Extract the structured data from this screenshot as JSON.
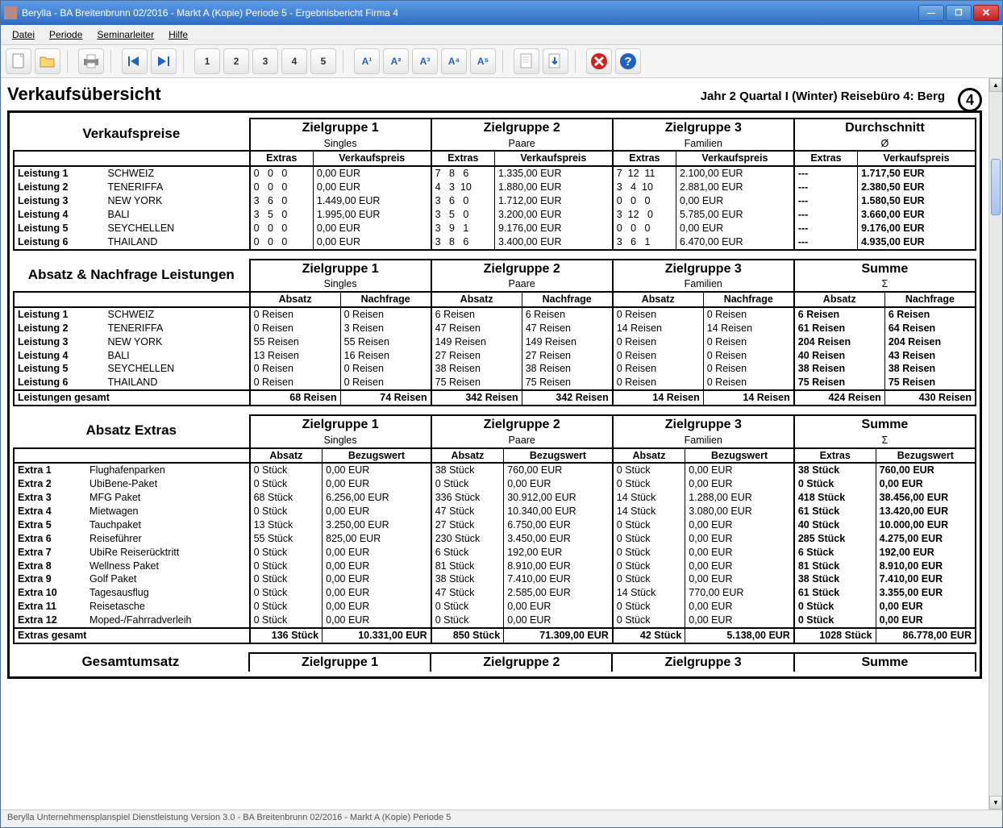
{
  "window_title": "Berylla - BA Breitenbrunn 02/2016 - Markt A (Kopie) Periode 5 - Ergebnisbericht Firma 4",
  "menu": [
    "Datei",
    "Periode",
    "Seminarleiter",
    "Hilfe"
  ],
  "toolbar_numbers": [
    "1",
    "2",
    "3",
    "4",
    "5"
  ],
  "toolbar_a": [
    "A¹",
    "A²",
    "A³",
    "A⁴",
    "A⁵"
  ],
  "page_title": "Verkaufsübersicht",
  "context": "Jahr 2  Quartal I (Winter)  Reisebüro 4: Berg",
  "circle": "4",
  "groups": {
    "g1": {
      "title": "Zielgruppe 1",
      "sub": "Singles"
    },
    "g2": {
      "title": "Zielgruppe 2",
      "sub": "Paare"
    },
    "g3": {
      "title": "Zielgruppe 3",
      "sub": "Familien"
    },
    "avg": {
      "title": "Durchschnitt",
      "sub": "Ø"
    },
    "sum": {
      "title": "Summe",
      "sub": "Σ"
    }
  },
  "block1": {
    "title": "Verkaufspreise",
    "cols": {
      "extras": "Extras",
      "vp": "Verkaufspreis"
    },
    "rows": [
      {
        "l": "Leistung 1",
        "d": "SCHWEIZ",
        "e1": "0   0   0",
        "p1": "0,00 EUR",
        "e2": "7   8   6",
        "p2": "1.335,00 EUR",
        "e3": "7  12  11",
        "p3": "2.100,00 EUR",
        "ea": "---",
        "pa": "1.717,50 EUR"
      },
      {
        "l": "Leistung 2",
        "d": "TENERIFFA",
        "e1": "0   0   0",
        "p1": "0,00 EUR",
        "e2": "4   3  10",
        "p2": "1.880,00 EUR",
        "e3": "3   4  10",
        "p3": "2.881,00 EUR",
        "ea": "---",
        "pa": "2.380,50 EUR"
      },
      {
        "l": "Leistung 3",
        "d": "NEW YORK",
        "e1": "3   6   0",
        "p1": "1.449,00 EUR",
        "e2": "3   6   0",
        "p2": "1.712,00 EUR",
        "e3": "0   0   0",
        "p3": "0,00 EUR",
        "ea": "---",
        "pa": "1.580,50 EUR"
      },
      {
        "l": "Leistung 4",
        "d": "BALI",
        "e1": "3   5   0",
        "p1": "1.995,00 EUR",
        "e2": "3   5   0",
        "p2": "3.200,00 EUR",
        "e3": "3  12   0",
        "p3": "5.785,00 EUR",
        "ea": "---",
        "pa": "3.660,00 EUR"
      },
      {
        "l": "Leistung 5",
        "d": "SEYCHELLEN",
        "e1": "0   0   0",
        "p1": "0,00 EUR",
        "e2": "3   9   1",
        "p2": "9.176,00 EUR",
        "e3": "0   0   0",
        "p3": "0,00 EUR",
        "ea": "---",
        "pa": "9.176,00 EUR"
      },
      {
        "l": "Leistung 6",
        "d": "THAILAND",
        "e1": "0   0   0",
        "p1": "0,00 EUR",
        "e2": "3   8   6",
        "p2": "3.400,00 EUR",
        "e3": "3   6   1",
        "p3": "6.470,00 EUR",
        "ea": "---",
        "pa": "4.935,00 EUR"
      }
    ]
  },
  "block2": {
    "title": "Absatz & Nachfrage Leistungen",
    "cols": {
      "a": "Absatz",
      "n": "Nachfrage"
    },
    "rows": [
      {
        "l": "Leistung 1",
        "d": "SCHWEIZ",
        "a1": "0 Reisen",
        "n1": "0 Reisen",
        "a2": "6 Reisen",
        "n2": "6 Reisen",
        "a3": "0 Reisen",
        "n3": "0 Reisen",
        "as": "6 Reisen",
        "ns": "6 Reisen"
      },
      {
        "l": "Leistung 2",
        "d": "TENERIFFA",
        "a1": "0 Reisen",
        "n1": "3 Reisen",
        "a2": "47 Reisen",
        "n2": "47 Reisen",
        "a3": "14 Reisen",
        "n3": "14 Reisen",
        "as": "61 Reisen",
        "ns": "64 Reisen"
      },
      {
        "l": "Leistung 3",
        "d": "NEW YORK",
        "a1": "55 Reisen",
        "n1": "55 Reisen",
        "a2": "149 Reisen",
        "n2": "149 Reisen",
        "a3": "0 Reisen",
        "n3": "0 Reisen",
        "as": "204 Reisen",
        "ns": "204 Reisen"
      },
      {
        "l": "Leistung 4",
        "d": "BALI",
        "a1": "13 Reisen",
        "n1": "16 Reisen",
        "a2": "27 Reisen",
        "n2": "27 Reisen",
        "a3": "0 Reisen",
        "n3": "0 Reisen",
        "as": "40 Reisen",
        "ns": "43 Reisen"
      },
      {
        "l": "Leistung 5",
        "d": "SEYCHELLEN",
        "a1": "0 Reisen",
        "n1": "0 Reisen",
        "a2": "38 Reisen",
        "n2": "38 Reisen",
        "a3": "0 Reisen",
        "n3": "0 Reisen",
        "as": "38 Reisen",
        "ns": "38 Reisen"
      },
      {
        "l": "Leistung 6",
        "d": "THAILAND",
        "a1": "0 Reisen",
        "n1": "0 Reisen",
        "a2": "75 Reisen",
        "n2": "75 Reisen",
        "a3": "0 Reisen",
        "n3": "0 Reisen",
        "as": "75 Reisen",
        "ns": "75 Reisen"
      }
    ],
    "total": {
      "l": "Leistungen gesamt",
      "a1": "68 Reisen",
      "n1": "74 Reisen",
      "a2": "342 Reisen",
      "n2": "342 Reisen",
      "a3": "14 Reisen",
      "n3": "14 Reisen",
      "as": "424 Reisen",
      "ns": "430 Reisen"
    }
  },
  "block3": {
    "title": "Absatz Extras",
    "cols": {
      "a": "Absatz",
      "b": "Bezugswert",
      "e": "Extras"
    },
    "rows": [
      {
        "l": "Extra 1",
        "d": "Flughafenparken",
        "a1": "0 Stück",
        "b1": "0,00 EUR",
        "a2": "38 Stück",
        "b2": "760,00 EUR",
        "a3": "0 Stück",
        "b3": "0,00 EUR",
        "as": "38 Stück",
        "bs": "760,00 EUR"
      },
      {
        "l": "Extra 2",
        "d": "UbiBene-Paket",
        "a1": "0 Stück",
        "b1": "0,00 EUR",
        "a2": "0 Stück",
        "b2": "0,00 EUR",
        "a3": "0 Stück",
        "b3": "0,00 EUR",
        "as": "0 Stück",
        "bs": "0,00 EUR"
      },
      {
        "l": "Extra 3",
        "d": "MFG Paket",
        "a1": "68 Stück",
        "b1": "6.256,00 EUR",
        "a2": "336 Stück",
        "b2": "30.912,00 EUR",
        "a3": "14 Stück",
        "b3": "1.288,00 EUR",
        "as": "418 Stück",
        "bs": "38.456,00 EUR"
      },
      {
        "l": "Extra 4",
        "d": "Mietwagen",
        "a1": "0 Stück",
        "b1": "0,00 EUR",
        "a2": "47 Stück",
        "b2": "10.340,00 EUR",
        "a3": "14 Stück",
        "b3": "3.080,00 EUR",
        "as": "61 Stück",
        "bs": "13.420,00 EUR"
      },
      {
        "l": "Extra 5",
        "d": "Tauchpaket",
        "a1": "13 Stück",
        "b1": "3.250,00 EUR",
        "a2": "27 Stück",
        "b2": "6.750,00 EUR",
        "a3": "0 Stück",
        "b3": "0,00 EUR",
        "as": "40 Stück",
        "bs": "10.000,00 EUR"
      },
      {
        "l": "Extra 6",
        "d": "Reiseführer",
        "a1": "55 Stück",
        "b1": "825,00 EUR",
        "a2": "230 Stück",
        "b2": "3.450,00 EUR",
        "a3": "0 Stück",
        "b3": "0,00 EUR",
        "as": "285 Stück",
        "bs": "4.275,00 EUR"
      },
      {
        "l": "Extra 7",
        "d": "UbiRe Reiserücktritt",
        "a1": "0 Stück",
        "b1": "0,00 EUR",
        "a2": "6 Stück",
        "b2": "192,00 EUR",
        "a3": "0 Stück",
        "b3": "0,00 EUR",
        "as": "6 Stück",
        "bs": "192,00 EUR"
      },
      {
        "l": "Extra 8",
        "d": "Wellness Paket",
        "a1": "0 Stück",
        "b1": "0,00 EUR",
        "a2": "81 Stück",
        "b2": "8.910,00 EUR",
        "a3": "0 Stück",
        "b3": "0,00 EUR",
        "as": "81 Stück",
        "bs": "8.910,00 EUR"
      },
      {
        "l": "Extra 9",
        "d": "Golf Paket",
        "a1": "0 Stück",
        "b1": "0,00 EUR",
        "a2": "38 Stück",
        "b2": "7.410,00 EUR",
        "a3": "0 Stück",
        "b3": "0,00 EUR",
        "as": "38 Stück",
        "bs": "7.410,00 EUR"
      },
      {
        "l": "Extra 10",
        "d": "Tagesausflug",
        "a1": "0 Stück",
        "b1": "0,00 EUR",
        "a2": "47 Stück",
        "b2": "2.585,00 EUR",
        "a3": "14 Stück",
        "b3": "770,00 EUR",
        "as": "61 Stück",
        "bs": "3.355,00 EUR"
      },
      {
        "l": "Extra 11",
        "d": "Reisetasche",
        "a1": "0 Stück",
        "b1": "0,00 EUR",
        "a2": "0 Stück",
        "b2": "0,00 EUR",
        "a3": "0 Stück",
        "b3": "0,00 EUR",
        "as": "0 Stück",
        "bs": "0,00 EUR"
      },
      {
        "l": "Extra 12",
        "d": "Moped-/Fahrradverleih",
        "a1": "0 Stück",
        "b1": "0,00 EUR",
        "a2": "0 Stück",
        "b2": "0,00 EUR",
        "a3": "0 Stück",
        "b3": "0,00 EUR",
        "as": "0 Stück",
        "bs": "0,00 EUR"
      }
    ],
    "total": {
      "l": "Extras gesamt",
      "a1": "136 Stück",
      "b1": "10.331,00 EUR",
      "a2": "850 Stück",
      "b2": "71.309,00 EUR",
      "a3": "42 Stück",
      "b3": "5.138,00 EUR",
      "as": "1028 Stück",
      "bs": "86.778,00 EUR"
    }
  },
  "block4_title": "Gesamtumsatz",
  "status": "Berylla Unternehmensplanspiel Dienstleistung Version 3.0 - BA Breitenbrunn 02/2016 - Markt A (Kopie) Periode 5"
}
